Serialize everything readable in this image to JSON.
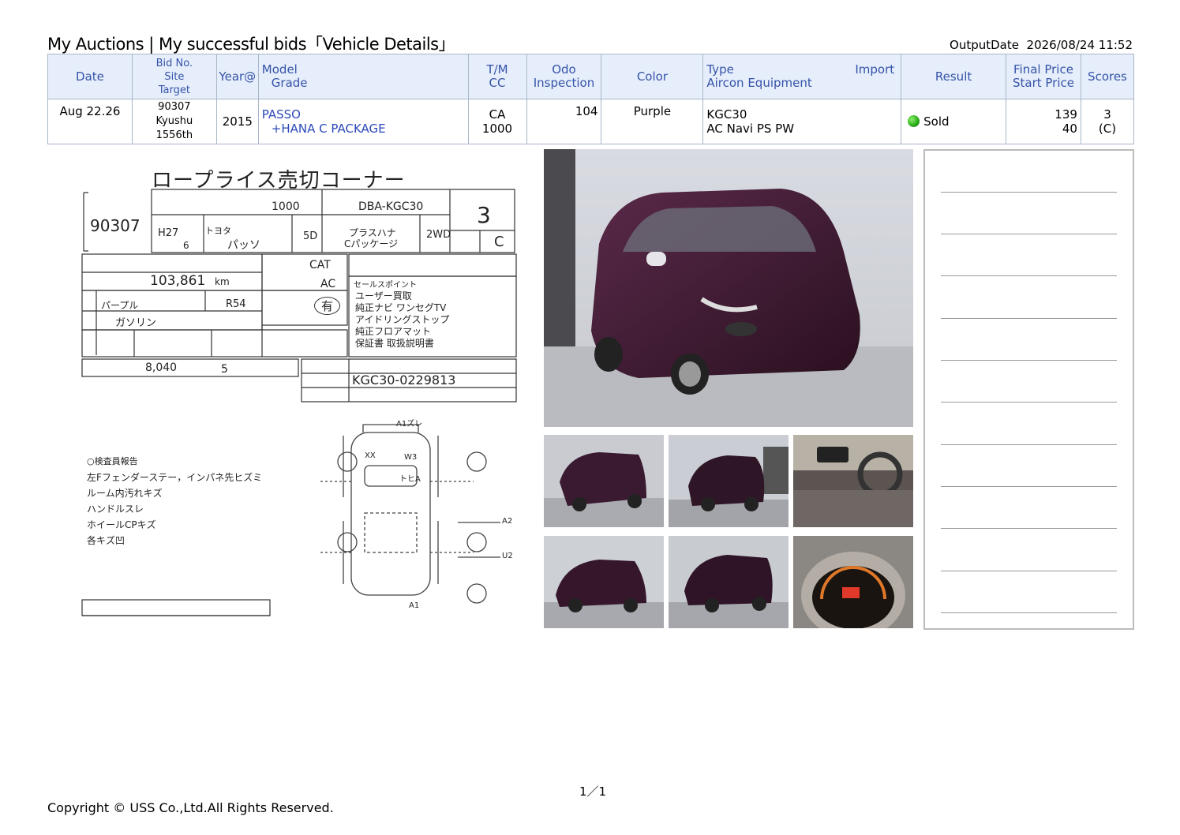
{
  "header": {
    "title": "My Auctions | My successful bids「Vehicle Details」",
    "output_date_label": "OutputDate",
    "output_date": "2026/08/24 11:52"
  },
  "table": {
    "headers": {
      "date": "Date",
      "bid_no": "Bid No.",
      "site": "Site",
      "target": "Target",
      "year": "Year@",
      "model": "Model",
      "grade": "Grade",
      "tm": "T/M",
      "cc": "CC",
      "odo": "Odo",
      "inspection": "Inspection",
      "color": "Color",
      "type": "Type",
      "import": "Import",
      "aircon_equipment": "Aircon Equipment",
      "result": "Result",
      "final_price": "Final Price",
      "start_price": "Start Price",
      "scores": "Scores"
    },
    "row": {
      "date": "Aug 22.26",
      "bid_no": "90307",
      "site": "Kyushu",
      "target": "1556th",
      "year": "2015",
      "model": "PASSO",
      "grade": "+HANA C PACKAGE",
      "tm": "CA",
      "cc": "1000",
      "odo": "104",
      "color": "Purple",
      "type": "KGC30",
      "equipment": "AC Navi PS PW",
      "result": "Sold",
      "final_price": "139",
      "start_price": "40",
      "score": "3",
      "score_sub": "(C)"
    }
  },
  "auction_sheet": {
    "header": "ロープライス売切コーナー",
    "lot_no": "90307",
    "displacement": "1000",
    "model_code": "DBA-KGC30",
    "score": "3",
    "interior_score": "C",
    "first_reg": "H27",
    "first_reg_month": "6",
    "maker": "トヨタ",
    "car_name": "パッソ",
    "doors": "5D",
    "grade_line1": "プラスハナ",
    "grade_line2": "Cパッケージ",
    "drive": "2WD",
    "shift": "CAT",
    "aircon": "AC",
    "mileage": "103,861",
    "mileage_unit": "km",
    "color": "パープル",
    "color_code": "R54",
    "fuel": "ガソリン",
    "manual": "有",
    "recycle_fee": "8,040",
    "capacity": "5",
    "chassis_no": "KGC30-0229813",
    "sales_points": [
      "セールスポイント",
      "ユーザー買取",
      "純正ナビ ワンセグTV",
      "アイドリングストップ",
      "純正フロアマット",
      "保証書 取扱説明書"
    ],
    "inspector_title": "○検査員報告",
    "inspector_notes": [
      "左Fフェンダーステー，インパネ先ヒズミ",
      "ルーム内汚れキズ",
      "ハンドルスレ",
      "ホイールCPキズ",
      "各キズ凹"
    ],
    "diagram_marks": [
      "A1ズレ",
      "XX",
      "W3",
      "トヒA",
      "A2",
      "U2",
      "A1"
    ]
  },
  "footer": {
    "page": "1／1",
    "copyright": "Copyright © USS Co.,Ltd.All Rights Reserved."
  },
  "colors": {
    "header_bg": "#e6eefb",
    "header_text": "#3553a8",
    "car_body": "#3a1a30",
    "sold": "#1fa312"
  }
}
